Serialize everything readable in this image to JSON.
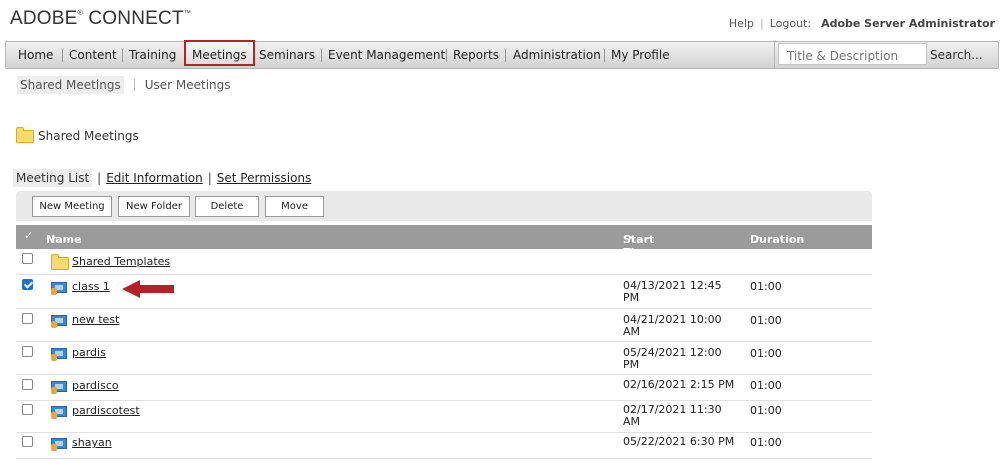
{
  "brand": {
    "name": "ADOBE",
    "reg": "®",
    "product": " CONNECT",
    "tm": "™"
  },
  "top_links": {
    "help": "Help",
    "logout": "Logout:",
    "user": "Adobe Server Administrator"
  },
  "nav": {
    "items": [
      "Home",
      "Content",
      "Training",
      "Meetings",
      "Seminars",
      "Event Management",
      "Reports",
      "Administration",
      "My Profile"
    ],
    "active": "Meetings",
    "search_placeholder": "Title & Description",
    "search_button": "Search..."
  },
  "subnav": {
    "items": [
      "Shared Meetings",
      "User Meetings"
    ],
    "selected": "Shared Meetings"
  },
  "folder": {
    "name": "Shared Meetings"
  },
  "tabs": {
    "items": [
      "Meeting List",
      "Edit Information",
      "Set Permissions"
    ],
    "selected": "Meeting List"
  },
  "toolbar": {
    "buttons": [
      "New Meeting",
      "New Folder",
      "Delete",
      "Move"
    ]
  },
  "table": {
    "columns": {
      "name": "Name",
      "start": "Start Time",
      "duration": "Duration"
    },
    "check_glyph": "✓",
    "sort_arrow": "▸",
    "rows": [
      {
        "type": "folder",
        "name": "Shared Templates",
        "start_1": "",
        "start_2": "",
        "duration": "",
        "checked": false
      },
      {
        "type": "meeting",
        "name": "class 1",
        "start_1": "04/13/2021 12:45",
        "start_2": "PM",
        "duration": "01:00",
        "checked": true
      },
      {
        "type": "meeting",
        "name": "new test",
        "start_1": "04/21/2021 10:00",
        "start_2": "AM",
        "duration": "01:00",
        "checked": false
      },
      {
        "type": "meeting",
        "name": "pardis",
        "start_1": "05/24/2021 12:00",
        "start_2": "PM",
        "duration": "01:00",
        "checked": false
      },
      {
        "type": "meeting",
        "name": "pardisco",
        "start_1": "02/16/2021 2:15 PM",
        "start_2": "",
        "duration": "01:00",
        "checked": false
      },
      {
        "type": "meeting",
        "name": "pardiscotest",
        "start_1": "02/17/2021 11:30",
        "start_2": "AM",
        "duration": "01:00",
        "checked": false
      },
      {
        "type": "meeting",
        "name": "shayan",
        "start_1": "05/22/2021 6:30 PM",
        "start_2": "",
        "duration": "01:00",
        "checked": false
      }
    ]
  },
  "colors": {
    "annotation_arrow": "#b5202a",
    "active_tab_border": "#b5202a",
    "table_header": "#9b9b9b"
  }
}
